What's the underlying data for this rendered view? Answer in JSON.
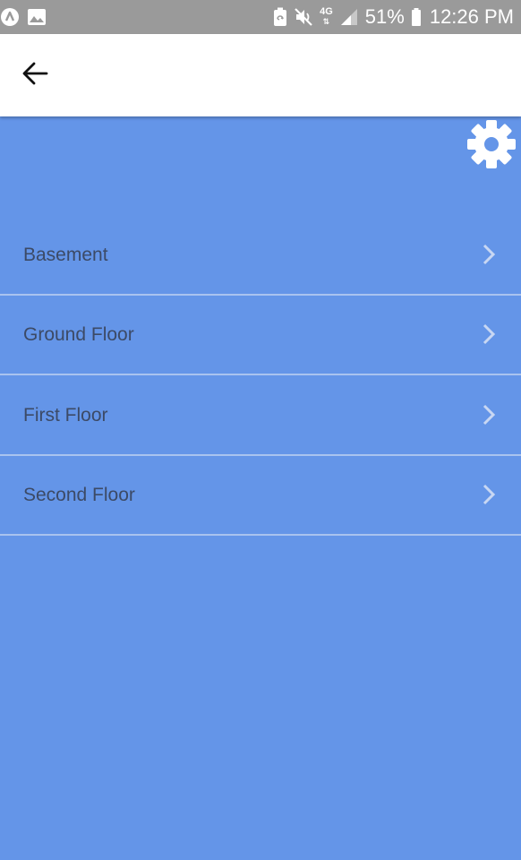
{
  "status_bar": {
    "battery_percent": "51%",
    "time": "12:26 PM",
    "network_type": "4G",
    "icons": [
      "notification-app-icon",
      "gallery-icon",
      "battery-saver-icon",
      "mute-icon",
      "network-4g-icon",
      "signal-icon",
      "battery-icon"
    ]
  },
  "app_bar": {
    "back_icon": "arrow-back-icon"
  },
  "settings": {
    "icon": "gear-icon"
  },
  "floors": [
    {
      "label": "Basement"
    },
    {
      "label": "Ground Floor"
    },
    {
      "label": "First Floor"
    },
    {
      "label": "Second Floor"
    }
  ],
  "colors": {
    "background": "#6495e8",
    "status_bar": "#9a9a9a",
    "app_bar": "#ffffff",
    "divider": "#a9c3ef",
    "label_text": "#3c4a66",
    "chevron": "#c8d7f3"
  }
}
